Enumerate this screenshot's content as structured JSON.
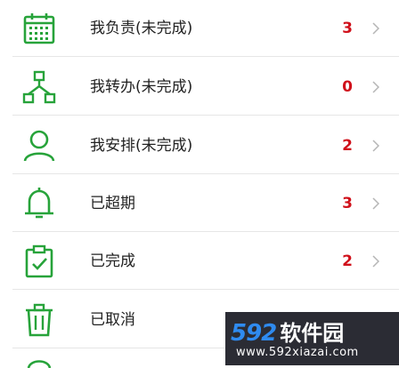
{
  "colors": {
    "accent": "#27a33a",
    "count": "#d0111b"
  },
  "items": [
    {
      "label": "我负责(未完成)",
      "count": "3",
      "icon": "calendar-icon"
    },
    {
      "label": "我转办(未完成)",
      "count": "0",
      "icon": "org-chart-icon"
    },
    {
      "label": "我安排(未完成)",
      "count": "2",
      "icon": "user-icon"
    },
    {
      "label": "已超期",
      "count": "3",
      "icon": "bell-icon"
    },
    {
      "label": "已完成",
      "count": "2",
      "icon": "clipboard-check-icon"
    },
    {
      "label": "已取消",
      "count": "",
      "icon": "trash-icon"
    }
  ],
  "watermark": {
    "brand_num": "592",
    "brand_name": "软件园",
    "url": "www.592xiazai.com"
  }
}
